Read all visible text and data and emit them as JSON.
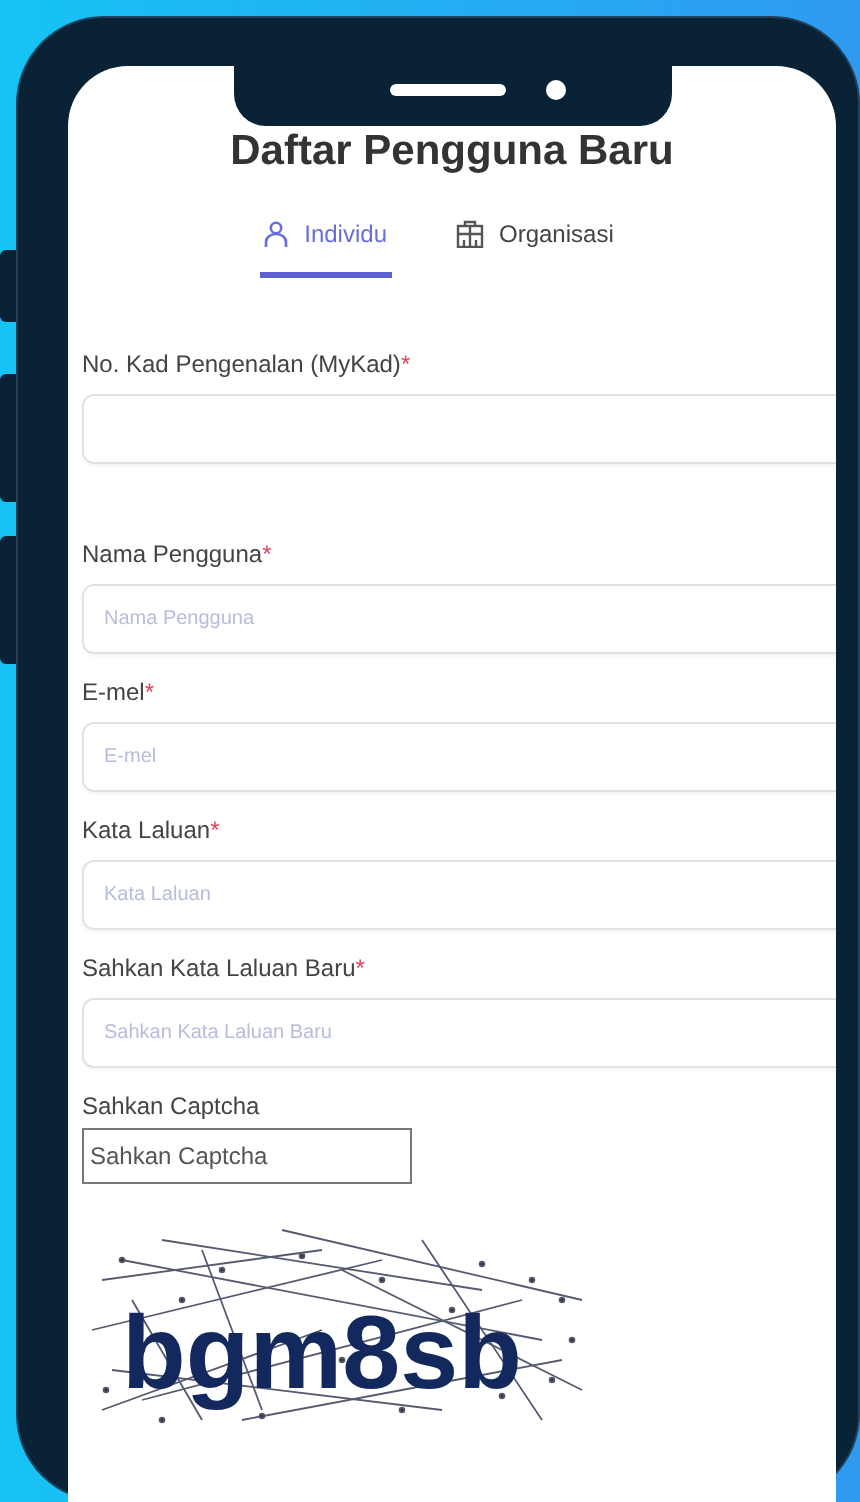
{
  "title": "Daftar Pengguna Baru",
  "tabs": [
    {
      "label": "Individu",
      "selected": true,
      "kind": "person"
    },
    {
      "label": "Organisasi",
      "selected": false,
      "kind": "building"
    }
  ],
  "fields": [
    {
      "label": "No. Kad Pengenalan (MyKad)",
      "required_mark": "*"
    },
    {
      "label": "Nama Pengguna",
      "required_mark": "*",
      "placeholder": "Nama Pengguna"
    },
    {
      "label": "E-mel",
      "required_mark": "*",
      "placeholder": "E-mel"
    },
    {
      "label": "Kata Laluan",
      "required_mark": "*",
      "placeholder": "Kata Laluan"
    },
    {
      "label": "Sahkan Kata Laluan Baru",
      "required_mark": "*",
      "placeholder": "Sahkan Kata Laluan Baru"
    }
  ],
  "captcha": {
    "label": "Sahkan Captcha",
    "placeholder": "Sahkan Captcha",
    "text": "bgm8sb"
  }
}
